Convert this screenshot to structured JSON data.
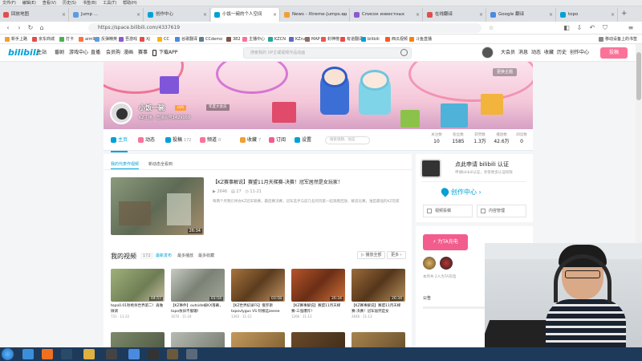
{
  "browser": {
    "menu": [
      "文件(F)",
      "编辑(E)",
      "查看(V)",
      "历史(S)",
      "书签(B)",
      "工具(T)",
      "帮助(H)"
    ],
    "tabs": [
      {
        "label": "回放地图",
        "color": "#e34d4d"
      },
      {
        "label": "Jump ...",
        "color": "#5a9de0"
      },
      {
        "label": "创作中心",
        "color": "#00a1d6"
      },
      {
        "label": "小饭一碗的个人空间",
        "color": "#00a1d6"
      },
      {
        "label": "News - Xtreme-Jumps.eu",
        "color": "#f0a030"
      },
      {
        "label": "Список известных",
        "color": "#8a5ad0"
      },
      {
        "label": "在线翻译",
        "color": "#e34d4d"
      },
      {
        "label": "Google 翻译",
        "color": "#4a8be0"
      },
      {
        "label": "topo",
        "color": "#00a1d6"
      }
    ],
    "address": "https://space.bilibili.com/4337619",
    "bookmarks": [
      {
        "label": "新手上路",
        "color": "#f0a030"
      },
      {
        "label": "京东商城",
        "color": "#e34d4d"
      },
      {
        "label": "打卡",
        "color": "#4caf50"
      },
      {
        "label": "aim99",
        "color": "#ff7043"
      },
      {
        "label": "反弹精英",
        "color": "#5a9de0"
      },
      {
        "label": "吾游戏",
        "color": "#8a5ad0"
      },
      {
        "label": "XJ",
        "color": "#e34d4d"
      },
      {
        "label": "CC",
        "color": "#ffb300"
      },
      {
        "label": "谷歌翻译",
        "color": "#4a8be0"
      },
      {
        "label": "CCdemo",
        "color": "#607d8b"
      },
      {
        "label": "382",
        "color": "#795548"
      },
      {
        "label": "主播中心",
        "color": "#fb7299"
      },
      {
        "label": "KZCN",
        "color": "#26a69a"
      },
      {
        "label": "KZru",
        "color": "#5c6bc0"
      },
      {
        "label": "MAP",
        "color": "#8d6e63"
      },
      {
        "label": "封神榜",
        "color": "#ef5350"
      },
      {
        "label": "有道翻译",
        "color": "#e34d4d"
      },
      {
        "label": "bilibili",
        "color": "#00a1d6"
      },
      {
        "label": "西瓜视频",
        "color": "#ff5722"
      },
      {
        "label": "斗鱼直播",
        "color": "#ff7f00"
      }
    ],
    "other_bookmarks": "移动设备上的书签"
  },
  "site": {
    "logo": "bilibili",
    "nav_left": [
      "主站",
      "番剧",
      "游戏中心",
      "直播",
      "会员购",
      "漫画",
      "赛事",
      "下载APP"
    ],
    "search_placeholder": "搜索我的 UP主或视频作品动画",
    "nav_right": [
      "大会员",
      "消息",
      "动态",
      "收藏",
      "历史",
      "创作中心"
    ],
    "upload": "投稿"
  },
  "profile": {
    "name": "小饭一碗",
    "level": "LV6",
    "badge": "年度大会员",
    "sign": "KZ主播，直播间号1429969",
    "theme_btn": "更换主题",
    "tabs": [
      {
        "label": "主页",
        "count": ""
      },
      {
        "label": "动态",
        "count": ""
      },
      {
        "label": "投稿",
        "count": "172"
      },
      {
        "label": "频道",
        "count": "0"
      },
      {
        "label": "收藏",
        "count": "7"
      },
      {
        "label": "订阅",
        "count": ""
      },
      {
        "label": "设置",
        "count": ""
      }
    ],
    "search_placeholder": "搜索视频、动态",
    "stats": [
      {
        "label": "关注数",
        "value": "10"
      },
      {
        "label": "粉丝数",
        "value": "1585"
      },
      {
        "label": "获赞数",
        "value": "1.3万"
      },
      {
        "label": "播放数",
        "value": "42.6万"
      },
      {
        "label": "阅读数",
        "value": "0"
      }
    ]
  },
  "main": {
    "subtabs": [
      "我的代表作视频",
      "新动态全看到"
    ],
    "featured": {
      "title": "【KZ赛事解说】赛盟11月天梯赛-决赛！冠军居然是女玩家！",
      "duration": "26:34",
      "plays": "2646",
      "comments": "27",
      "date": "11-21",
      "desc": "每两个月我们举办KZ冠军联赛，最后赛决赛，冠军选手与前几名的玩家一起观看回放、解说比赛，谁是最强的KZ玩家"
    },
    "myvideos_title": "我的视频",
    "myvideos_count": "172",
    "sort": [
      "最新发布",
      "最多播放",
      "最多收藏"
    ],
    "play_all": "播放全部",
    "more": "更多",
    "videos": [
      {
        "title": "topo0.01秒绝杀世界第二！再做微调",
        "duration": "04:57",
        "plays": "731",
        "date": "11-22"
      },
      {
        "title": "【KZ事件】outside被KX落幕，topo依旧不服输！",
        "duration": "01:54",
        "plays": "1670",
        "date": "11-24"
      },
      {
        "title": "【KZ世界纪录FS】俄罗斯topovlygus VS 阿根廷zeeee",
        "duration": "03:58",
        "plays": "1393",
        "date": "11-21"
      },
      {
        "title": "【KZ赛事解说】赛盟11月天梯赛-三强爆炸！",
        "duration": "26:34",
        "plays": "1266",
        "date": "11-12"
      },
      {
        "title": "【KZ赛事解说】赛盟11月天梯赛-决赛！冠军居然是女",
        "duration": "26:34",
        "plays": "2646",
        "date": "11-13"
      }
    ]
  },
  "sidebar": {
    "verify_title": "点此申请 bilibili 认证",
    "verify_sub": "申请bilibili认证，享受更多认证权限",
    "creator": "创作中心",
    "btn_upload": "视频投稿",
    "btn_manage": "内容管理",
    "charge": "为TA充电",
    "charge_note": "本月共 2人为TA充电",
    "announce": "公告"
  }
}
